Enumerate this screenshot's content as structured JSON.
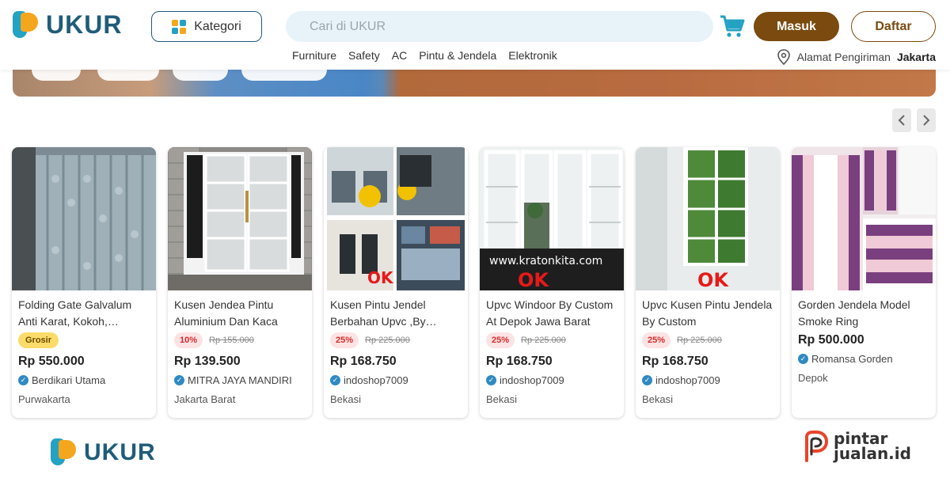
{
  "brand": {
    "name": "UKUR"
  },
  "header": {
    "kategori_label": "Kategori",
    "search_placeholder": "Cari di UKUR",
    "login_label": "Masuk",
    "register_label": "Daftar",
    "quick_links": [
      "Furniture",
      "Safety",
      "AC",
      "Pintu & Jendela",
      "Elektronik"
    ],
    "address_label": "Alamat Pengiriman",
    "address_city": "Jakarta"
  },
  "colors": {
    "brand_dark": "#1f5c7a",
    "brand_blue": "#24a2c4",
    "brand_orange": "#f4a61d",
    "login_bg": "#7a4a0f",
    "discount": "#d62b2b"
  },
  "products": [
    {
      "name": "Folding Gate Galvalum Anti Karat, Kokoh, Berkualitas ...",
      "badge": "Grosir",
      "discount": "",
      "old_price": "",
      "price": "Rp 550.000",
      "seller": "Berdikari Utama",
      "city": "Purwakarta"
    },
    {
      "name": "Kusen Jendea Pintu Aluminium Dan Kaca",
      "badge": "",
      "discount": "10%",
      "old_price": "Rp 155.000",
      "price": "Rp 139.500",
      "seller": "MITRA JAYA MANDIRI",
      "city": "Jakarta Barat"
    },
    {
      "name": "Kusen Pintu Jendel Berbahan Upvc ,By Custo...",
      "badge": "",
      "discount": "25%",
      "old_price": "Rp 225.000",
      "price": "Rp 168.750",
      "seller": "indoshop7009",
      "city": "Bekasi"
    },
    {
      "name": "Upvc Windoor By Custom At Depok Jawa Barat",
      "badge": "",
      "discount": "25%",
      "old_price": "Rp 225.000",
      "price": "Rp 168.750",
      "seller": "indoshop7009",
      "city": "Bekasi"
    },
    {
      "name": "Upvc Kusen Pintu Jendela By Custom",
      "badge": "",
      "discount": "25%",
      "old_price": "Rp 225.000",
      "price": "Rp 168.750",
      "seller": "indoshop7009",
      "city": "Bekasi"
    },
    {
      "name": "Gorden Jendela Model Smoke Ring",
      "badge": "",
      "discount": "",
      "old_price": "",
      "price": "Rp 500.000",
      "seller": "Romansa Gorden",
      "city": "Depok"
    }
  ],
  "thumb_text": {
    "kratonkita": "www.kratonkita.com",
    "ok": "OK"
  },
  "footer": {
    "pintar_line1": "pintar",
    "pintar_line2": "jualan.id"
  }
}
